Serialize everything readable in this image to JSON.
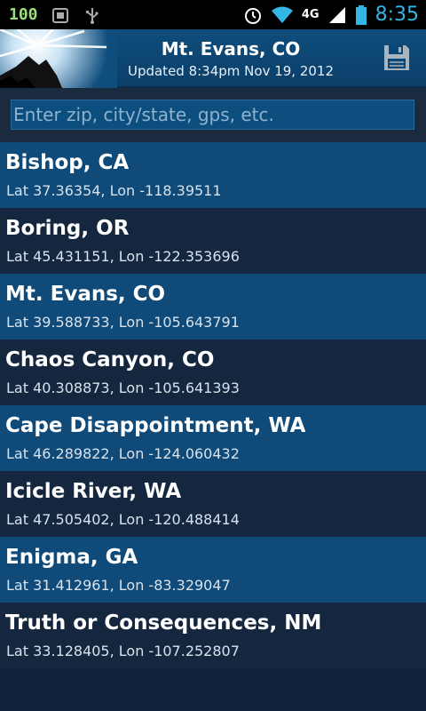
{
  "status_bar": {
    "battery_level": "100",
    "network": "4G",
    "time": "8:35"
  },
  "header": {
    "title": "Mt. Evans, CO",
    "subtitle": "Updated 8:34pm Nov 19, 2012"
  },
  "search": {
    "value": "",
    "placeholder": "Enter zip, city/state, gps, etc."
  },
  "locations": [
    {
      "name": "Bishop, CA",
      "coords": "Lat 37.36354, Lon -118.39511"
    },
    {
      "name": "Boring, OR",
      "coords": "Lat 45.431151, Lon -122.353696"
    },
    {
      "name": "Mt. Evans, CO",
      "coords": "Lat 39.588733, Lon -105.643791"
    },
    {
      "name": "Chaos Canyon, CO",
      "coords": "Lat 40.308873, Lon -105.641393"
    },
    {
      "name": "Cape Disappointment, WA",
      "coords": "Lat 46.289822, Lon -124.060432"
    },
    {
      "name": "Icicle River, WA",
      "coords": "Lat 47.505402, Lon -120.488414"
    },
    {
      "name": "Enigma, GA",
      "coords": "Lat 31.412961, Lon -83.329047"
    },
    {
      "name": "Truth or Consequences, NM",
      "coords": "Lat 33.128405, Lon -107.252807"
    }
  ],
  "icons": {
    "status_left": [
      "battery-level-icon",
      "notification-icon",
      "usb-icon"
    ],
    "status_right": [
      "alarm-icon",
      "wifi-icon",
      "network-4g-icon",
      "signal-icon",
      "battery-icon"
    ],
    "header": [
      "app-logo-icon",
      "save-icon"
    ]
  },
  "colors": {
    "status_bar": "#000000",
    "header": "#0f4d7c",
    "row_odd": "#0f4a78",
    "row_even": "#14273e",
    "clock": "#33b5e5",
    "battery_text": "#9ae07a"
  }
}
